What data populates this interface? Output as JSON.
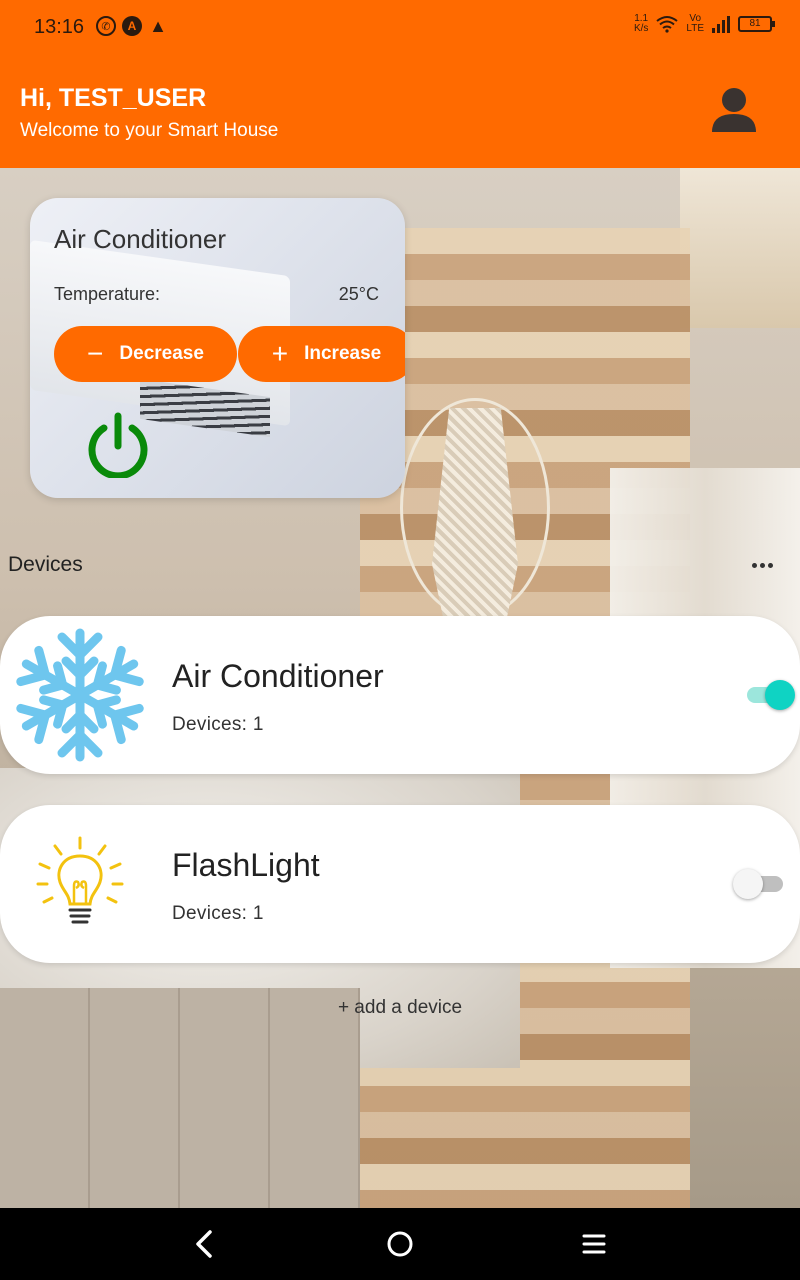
{
  "status_bar": {
    "time": "13:16",
    "net_speed_top": "1.1",
    "net_speed_bottom": "K/s",
    "volte_top": "Vo",
    "volte_bottom": "LTE",
    "battery": "81",
    "icons": [
      "whatsapp-icon",
      "a-icon",
      "warning-icon",
      "wifi-icon",
      "signal-icon",
      "battery-icon"
    ]
  },
  "header": {
    "greeting": "Hi, TEST_USER",
    "subtitle": "Welcome to your Smart House",
    "profile_icon": "person-icon"
  },
  "ac_control": {
    "title": "Air Conditioner",
    "temperature_label": "Temperature:",
    "temperature_value": "25°C",
    "decrease_label": "Decrease",
    "increase_label": "Increase",
    "power_icon": "power-icon",
    "power_color": "#0a8a0a"
  },
  "devices": {
    "title": "Devices",
    "items": [
      {
        "name": "Air Conditioner",
        "count": "Devices: 1",
        "icon": "snowflake-icon",
        "enabled": true
      },
      {
        "name": "FlashLight",
        "count": "Devices: 1",
        "icon": "lightbulb-icon",
        "enabled": false
      }
    ],
    "add_label": "+ add a device"
  },
  "colors": {
    "accent": "#ff6a00",
    "toggle_on": "#0fd3c3",
    "snowflake": "#6ec6ee",
    "bulb": "#f3c20f"
  }
}
